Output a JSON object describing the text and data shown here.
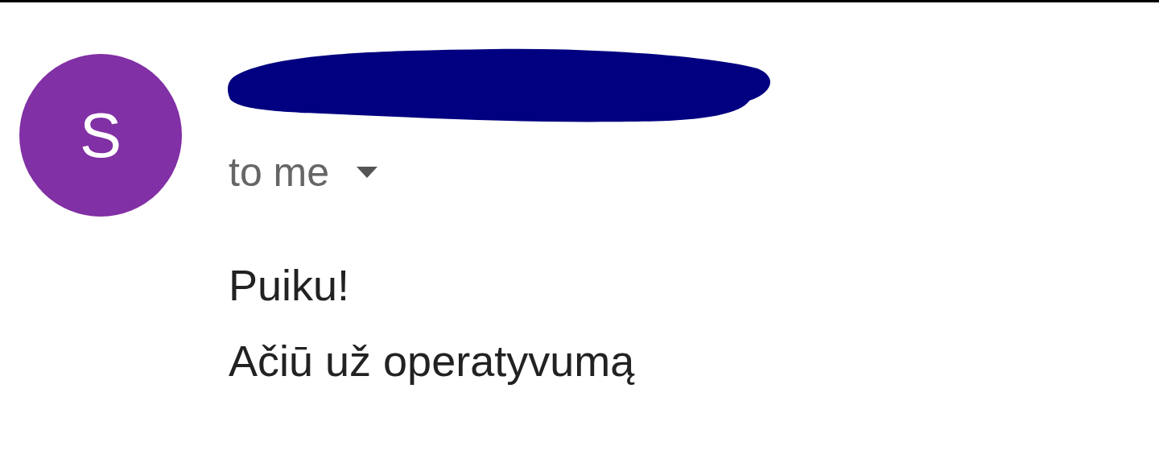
{
  "sender": {
    "avatar_letter": "S"
  },
  "recipient": "to me",
  "body": [
    "Puiku!",
    "Ačiū už operatyvumą"
  ]
}
